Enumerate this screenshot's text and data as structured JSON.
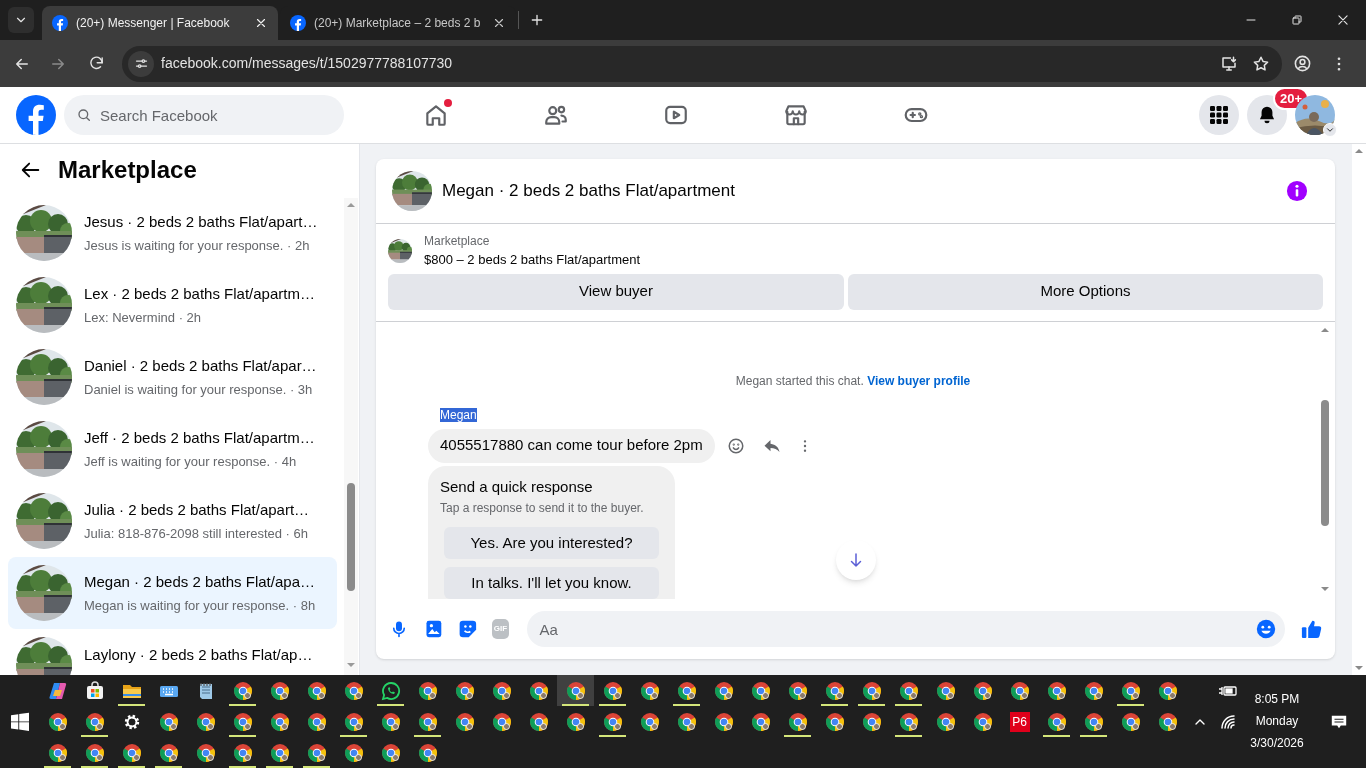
{
  "browser": {
    "tabs": [
      {
        "title": "(20+) Messenger | Facebook",
        "selected": true
      },
      {
        "title": "(20+) Marketplace – 2 beds 2 b",
        "selected": false
      }
    ],
    "url": "facebook.com/messages/t/1502977788107730"
  },
  "header": {
    "search_placeholder": "Search Facebook",
    "nav": [
      {
        "kind": "home",
        "badge": true
      },
      {
        "kind": "friends",
        "badge": false
      },
      {
        "kind": "video",
        "badge": false
      },
      {
        "kind": "marketplace",
        "badge": false
      },
      {
        "kind": "gaming",
        "badge": false
      }
    ],
    "notification_count": "20+"
  },
  "sidebar": {
    "title": "Marketplace",
    "conversations": [
      {
        "title": "Jesus · 2 beds 2 baths Flat/apart…",
        "subtitle": "Jesus is waiting for your response. · 2h",
        "selected": false
      },
      {
        "title": "Lex · 2 beds 2 baths Flat/apartm…",
        "subtitle": "Lex: Nevermind · 2h",
        "selected": false
      },
      {
        "title": "Daniel · 2 beds 2 baths Flat/apar…",
        "subtitle": "Daniel is waiting for your response. · 3h",
        "selected": false
      },
      {
        "title": "Jeff · 2 beds 2 baths Flat/apartm…",
        "subtitle": "Jeff is waiting for your response. · 4h",
        "selected": false
      },
      {
        "title": "Julia · 2 beds 2 baths Flat/apart…",
        "subtitle": "Julia: 818-876-2098 still interested · 6h",
        "selected": false
      },
      {
        "title": "Megan · 2 beds 2 baths Flat/apa…",
        "subtitle": "Megan is waiting for your response. · 8h",
        "selected": true
      },
      {
        "title": "Laylony · 2 beds 2 baths Flat/ap…",
        "selected": false
      }
    ]
  },
  "chat": {
    "title": "Megan · 2 beds 2 baths Flat/apartment",
    "listing": {
      "label": "Marketplace",
      "name": "$800 – 2 beds 2 baths Flat/apartment"
    },
    "buttons": [
      "View buyer",
      "More Options"
    ],
    "system_message": "Megan started this chat.",
    "system_link": "View buyer profile",
    "sender": {
      "name": "Megan",
      "highlighted": true
    },
    "message": "4055517880 can come tour before 2pm",
    "quick_response": {
      "title": "Send a quick response",
      "subtitle": "Tap a response to send it to the buyer.",
      "options": [
        "Yes. Are you interested?",
        "In talks. I'll let you know."
      ]
    },
    "composer": {
      "placeholder": "Aa",
      "gif_label": "GIF"
    }
  },
  "taskbar": {
    "rows": [
      [
        {
          "kind": "copilot",
          "running": false,
          "selected": false
        },
        {
          "kind": "store",
          "running": false,
          "selected": false
        },
        {
          "kind": "folder",
          "running": true,
          "selected": false
        },
        {
          "kind": "keyboard",
          "running": false,
          "selected": false
        },
        {
          "kind": "notepad",
          "running": false,
          "selected": false
        },
        {
          "kind": "chrome",
          "running": true,
          "selected": false
        },
        {
          "kind": "chrome",
          "running": false,
          "selected": false
        },
        {
          "kind": "chrome",
          "running": false,
          "selected": false
        },
        {
          "kind": "chrome",
          "running": false,
          "selected": false
        },
        {
          "kind": "whatsapp",
          "running": true,
          "selected": false
        },
        {
          "kind": "chrome",
          "running": false,
          "selected": false
        },
        {
          "kind": "chrome",
          "running": false,
          "selected": false
        },
        {
          "kind": "chrome",
          "running": false,
          "selected": false
        },
        {
          "kind": "chrome",
          "running": false,
          "selected": false
        },
        {
          "kind": "chrome",
          "running": true,
          "selected": true
        },
        {
          "kind": "chrome",
          "running": true,
          "selected": false
        },
        {
          "kind": "chrome",
          "running": false,
          "selected": false
        },
        {
          "kind": "chrome",
          "running": true,
          "selected": false
        },
        {
          "kind": "chrome",
          "running": false,
          "selected": false
        },
        {
          "kind": "chrome",
          "running": false,
          "selected": false
        },
        {
          "kind": "chrome",
          "running": false,
          "selected": false
        },
        {
          "kind": "chrome",
          "running": true,
          "selected": false
        },
        {
          "kind": "chrome",
          "running": true,
          "selected": false
        },
        {
          "kind": "chrome",
          "running": true,
          "selected": false
        },
        {
          "kind": "chrome",
          "running": false,
          "selected": false
        },
        {
          "kind": "chrome",
          "running": false,
          "selected": false
        },
        {
          "kind": "chrome",
          "running": false,
          "selected": false
        },
        {
          "kind": "chrome",
          "running": false,
          "selected": false
        },
        {
          "kind": "chrome",
          "running": false,
          "selected": false
        },
        {
          "kind": "chrome",
          "running": true,
          "selected": false
        },
        {
          "kind": "chrome",
          "running": false,
          "selected": false
        }
      ],
      [
        {
          "kind": "chrome",
          "running": false,
          "selected": false
        },
        {
          "kind": "chrome",
          "running": true,
          "selected": false
        },
        {
          "kind": "settings",
          "running": false,
          "selected": false
        },
        {
          "kind": "chrome",
          "running": false,
          "selected": false
        },
        {
          "kind": "chrome",
          "running": false,
          "selected": false
        },
        {
          "kind": "chrome",
          "running": true,
          "selected": false
        },
        {
          "kind": "chrome",
          "running": false,
          "selected": false
        },
        {
          "kind": "chrome",
          "running": false,
          "selected": false
        },
        {
          "kind": "chrome",
          "running": true,
          "selected": false
        },
        {
          "kind": "chrome",
          "running": false,
          "selected": false
        },
        {
          "kind": "chrome",
          "running": true,
          "selected": false
        },
        {
          "kind": "chrome",
          "running": false,
          "selected": false
        },
        {
          "kind": "chrome",
          "running": false,
          "selected": false
        },
        {
          "kind": "chrome",
          "running": false,
          "selected": false
        },
        {
          "kind": "chrome",
          "running": false,
          "selected": false
        },
        {
          "kind": "chrome",
          "running": true,
          "selected": false
        },
        {
          "kind": "chrome",
          "running": false,
          "selected": false
        },
        {
          "kind": "chrome",
          "running": false,
          "selected": false
        },
        {
          "kind": "chrome",
          "running": false,
          "selected": false
        },
        {
          "kind": "chrome",
          "running": false,
          "selected": false
        },
        {
          "kind": "chrome",
          "running": true,
          "selected": false
        },
        {
          "kind": "chrome",
          "running": false,
          "selected": false
        },
        {
          "kind": "chrome",
          "running": false,
          "selected": false
        },
        {
          "kind": "chrome",
          "running": true,
          "selected": false
        },
        {
          "kind": "chrome",
          "running": false,
          "selected": false
        },
        {
          "kind": "chrome",
          "running": false,
          "selected": false
        },
        {
          "kind": "p6",
          "label": "P6",
          "running": false,
          "selected": false
        },
        {
          "kind": "chrome",
          "running": true,
          "selected": false
        },
        {
          "kind": "chrome",
          "running": true,
          "selected": false
        },
        {
          "kind": "chrome",
          "running": false,
          "selected": false
        },
        {
          "kind": "chrome",
          "running": false,
          "selected": false
        }
      ],
      [
        {
          "kind": "chrome",
          "running": true,
          "selected": false
        },
        {
          "kind": "chrome",
          "running": true,
          "selected": false
        },
        {
          "kind": "chrome",
          "running": true,
          "selected": false
        },
        {
          "kind": "chrome",
          "running": true,
          "selected": false
        },
        {
          "kind": "chrome",
          "running": false,
          "selected": false
        },
        {
          "kind": "chrome",
          "running": true,
          "selected": false
        },
        {
          "kind": "chrome",
          "running": true,
          "selected": false
        },
        {
          "kind": "chrome",
          "running": true,
          "selected": false
        },
        {
          "kind": "chrome",
          "running": false,
          "selected": false
        },
        {
          "kind": "chrome",
          "running": false,
          "selected": false
        },
        {
          "kind": "chrome",
          "running": false,
          "selected": false
        }
      ]
    ],
    "clock": {
      "time": "8:05 PM",
      "day": "Monday",
      "date": "3/30/2026"
    }
  }
}
